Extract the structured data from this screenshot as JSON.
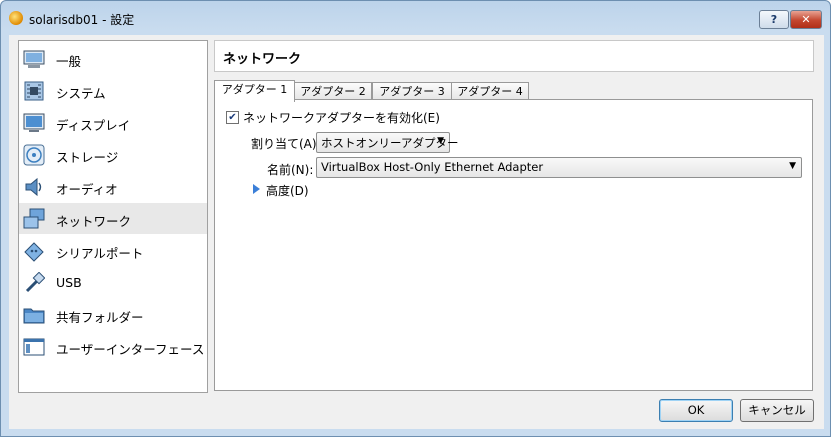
{
  "window": {
    "title": "solarisdb01 - 設定",
    "help_label": "?",
    "close_label": "✕"
  },
  "sidebar": {
    "items": [
      {
        "label": "一般",
        "icon": "monitor-icon"
      },
      {
        "label": "システム",
        "icon": "chip-icon"
      },
      {
        "label": "ディスプレイ",
        "icon": "display-icon"
      },
      {
        "label": "ストレージ",
        "icon": "disk-icon"
      },
      {
        "label": "オーディオ",
        "icon": "speaker-icon"
      },
      {
        "label": "ネットワーク",
        "icon": "network-icon"
      },
      {
        "label": "シリアルポート",
        "icon": "serial-port-icon"
      },
      {
        "label": "USB",
        "icon": "usb-icon"
      },
      {
        "label": "共有フォルダー",
        "icon": "folder-icon"
      },
      {
        "label": "ユーザーインターフェース",
        "icon": "ui-icon"
      }
    ],
    "selected": "ネットワーク"
  },
  "main": {
    "title": "ネットワーク",
    "tabs": [
      {
        "label": "アダプター 1"
      },
      {
        "label": "アダプター 2"
      },
      {
        "label": "アダプター 3"
      },
      {
        "label": "アダプター 4"
      }
    ],
    "active_tab": "アダプター 1",
    "enable_adapter": {
      "label": "ネットワークアダプターを有効化(E)",
      "checked": true
    },
    "attached_to": {
      "label": "割り当て(A):",
      "value": "ホストオンリーアダプター"
    },
    "name": {
      "label": "名前(N):",
      "value": "VirtualBox Host-Only Ethernet Adapter"
    },
    "advanced": {
      "label": "高度(D)"
    }
  },
  "buttons": {
    "ok": "OK",
    "cancel": "キャンセル"
  },
  "colors": {
    "title_bar": "#c9dcef",
    "close_button": "#c4472f",
    "expand_arrow": "#3b7fd8"
  }
}
